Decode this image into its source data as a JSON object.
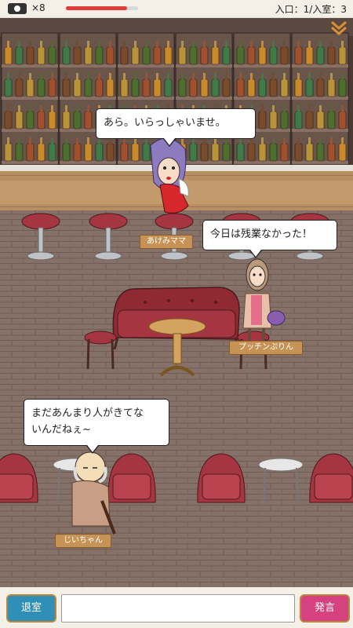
{
  "status": {
    "visibility_icon": "eye-icon",
    "visibility_count": "×8",
    "health_level": 0.85,
    "room_info": "入口：1/入室：3",
    "menu_icon": "double-chevron-down-icon"
  },
  "dialogue": {
    "mama": "あら。いらっしゃいませ。",
    "puchin": "今日は残業なかった！",
    "jiichan_line1": "まだあんまり人がきてな",
    "jiichan_line2": "いんだねぇ~"
  },
  "characters": {
    "mama_name": "あけみママ",
    "puchin_name": "プッチンぷりん",
    "jiichan_name": "じいちゃん"
  },
  "controls": {
    "exit_label": "退室",
    "speak_label": "発言",
    "message_value": ""
  },
  "colors": {
    "exit_button": "#2f8fb6",
    "speak_button": "#d6427f",
    "accent_red": "#e03b3b"
  }
}
